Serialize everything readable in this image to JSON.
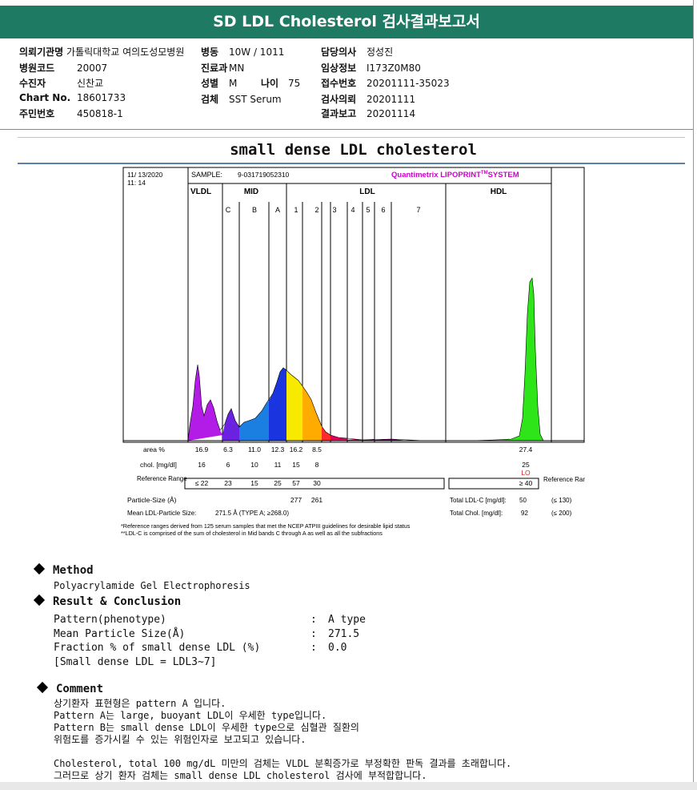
{
  "header": {
    "title": "SD LDL Cholesterol 검사결과보고서"
  },
  "info": {
    "col1": [
      {
        "label": "의뢰기관명",
        "value": "가톨릭대학교 여의도성모병원"
      },
      {
        "label": "병원코드",
        "value": "20007"
      },
      {
        "label": "수진자",
        "value": "신찬교"
      },
      {
        "label": "Chart No.",
        "value": "18601733"
      },
      {
        "label": "주민번호",
        "value": "450818-1"
      }
    ],
    "col2": {
      "ward_label": "병동",
      "ward_value": "10W / 1011",
      "dept_label": "진료과",
      "dept_value": "MN",
      "sex_label": "성별",
      "sex_value": "M",
      "age_label": "나이",
      "age_value": "75",
      "specimen_label": "검체",
      "specimen_value": "SST Serum"
    },
    "col3": [
      {
        "label": "담당의사",
        "value": "정성진"
      },
      {
        "label": "임상정보",
        "value": "I173Z0M80"
      },
      {
        "label": "접수번호",
        "value": "20201111-35023"
      },
      {
        "label": "검사의뢰",
        "value": "20201111"
      },
      {
        "label": "결과보고",
        "value": "20201114"
      }
    ]
  },
  "subtitle": "small dense LDL cholesterol",
  "report": {
    "date": "11/ 13/2020",
    "time": "11: 14",
    "sample_label": "SAMPLE:",
    "sample_id": "9-031719052310",
    "brand": "Quantimetrix LIPOPRINT",
    "brand_tm": "TM",
    "brand_system": "SYSTEM",
    "groups": [
      "VLDL",
      "MID",
      "LDL",
      "HDL"
    ],
    "bands": [
      "C",
      "B",
      "A",
      "1",
      "2",
      "3",
      "4",
      "5",
      "6",
      "7"
    ],
    "row_labels": {
      "area": "area %",
      "chol": "chol. [mg/dl]",
      "ref": "Reference Range",
      "psize": "Particle-Size (Å)",
      "mean": "Mean LDL-Particle Size:"
    },
    "area": [
      "16.9",
      "6.3",
      "11.0",
      "12.3",
      "16.2",
      "8.5",
      "27.4"
    ],
    "chol": [
      "16",
      "6",
      "10",
      "11",
      "15",
      "8",
      "25"
    ],
    "hdl_flag": "LO",
    "ref": [
      "≤ 22",
      "23",
      "15",
      "25",
      "57",
      "30",
      "≥ 40"
    ],
    "psize": [
      "277",
      "261"
    ],
    "mean_value": "271.5 Å  (TYPE A; ≥268.0)",
    "ref_right": "Reference Range",
    "total_ldl_label": "Total LDL-C [mg/dl]:",
    "total_ldl_value": "50",
    "total_ldl_ref": "(≤ 130)",
    "total_chol_label": "Total Chol. [mg/dl]:",
    "total_chol_value": "92",
    "total_chol_ref": "(≤ 200)",
    "footnote1": "*Reference ranges derived from 125 serum samples that met the NCEP ATPIII guidelines for desirable lipid status",
    "footnote2": "**LDL-C is comprised of the sum of cholesterol in Mid bands C through A as well as all the subfractions"
  },
  "method": {
    "heading": "Method",
    "text": "Polyacrylamide Gel Electrophoresis"
  },
  "result": {
    "heading": "Result & Conclusion",
    "rows": [
      {
        "label": "Pattern(phenotype)",
        "value": "A type"
      },
      {
        "label": "Mean Particle Size(Å)",
        "value": "271.5"
      },
      {
        "label": "Fraction % of small dense LDL (%)",
        "value": "0.0"
      }
    ],
    "note": "[Small dense LDL = LDL3~7]",
    "colon": ":"
  },
  "comment": {
    "heading": "Comment",
    "lines": [
      "상기환자 표현형은 pattern A 입니다.",
      "Pattern A는 large, buoyant LDL이 우세한 type입니다.",
      "Pattern B는 small dense LDL이 우세한 type으로 심혈관 질환의",
      "위험도를 증가시킬 수 있는 위험인자로 보고되고 있습니다.",
      "",
      "Cholesterol, total 100 mg/dL 미만의 검체는 VLDL 분획증가로 부정확한 판독 결과를 초래합니다.",
      "그러므로 상기 환자 검체는 small dense LDL cholesterol 검사에 부적합합니다."
    ]
  },
  "colors": {
    "header_bg": "#1f7a63",
    "brand": "#cc00cc",
    "flag": "#e02020"
  }
}
